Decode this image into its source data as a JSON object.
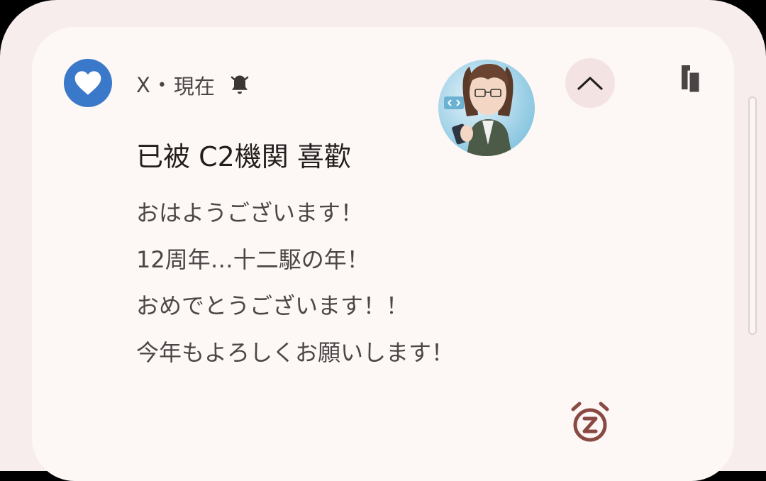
{
  "notification": {
    "app_name": "X",
    "separator": "•",
    "time": "現在",
    "title": "已被 C2機関 喜歡",
    "body_lines": [
      "おはようございます！",
      "12周年…十二駆の年！",
      "おめでとうございます！！",
      "今年もよろしくお願いします！"
    ]
  },
  "icons": {
    "app": "heart-icon",
    "alert": "bell-icon",
    "collapse": "chevron-up-icon",
    "bubble": "bubble-icon",
    "snooze": "snooze-alarm-icon"
  },
  "colors": {
    "app_icon_bg": "#3a78c9",
    "snooze": "#8a4a44"
  }
}
